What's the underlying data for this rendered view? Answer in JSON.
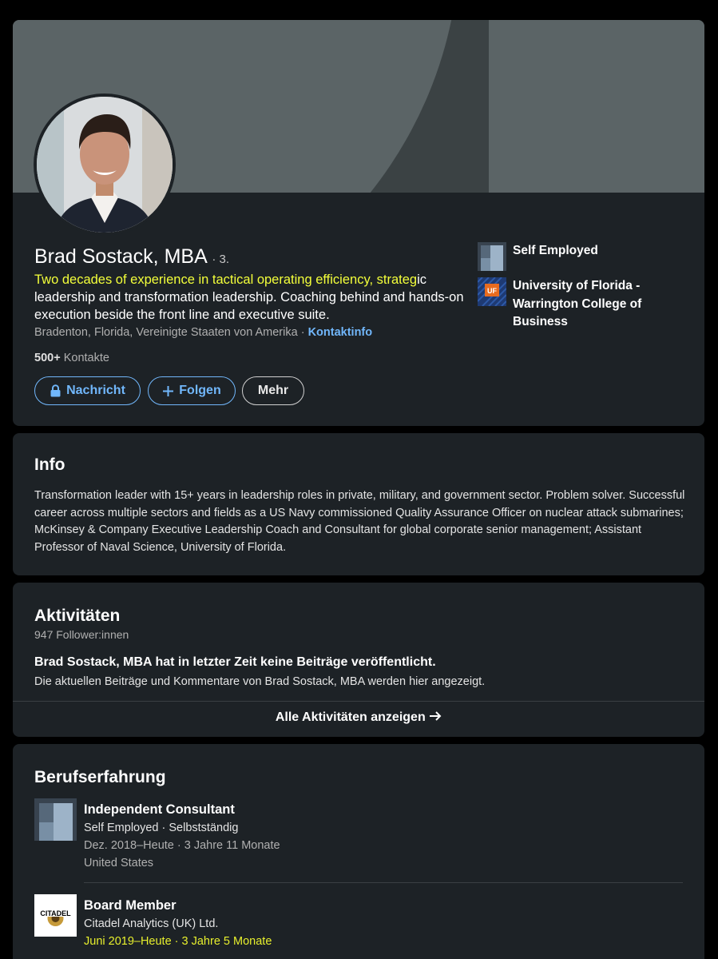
{
  "profile": {
    "name": "Brad Sostack, MBA",
    "degree": "· 3.",
    "headline_highlight": "Two decades of experience in tactical operating efficiency, strateg",
    "headline_rest": "ic leadership and transformation leadership. Coaching behind and hands-on execution beside the front line and executive suite.",
    "location": "Bradenton, Florida, Vereinigte Staaten von Amerika ·",
    "contact_link": "Kontaktinfo",
    "contacts_count": "500+",
    "contacts_label": "Kontakte",
    "buttons": {
      "message": "Nachricht",
      "follow": "Folgen",
      "more": "Mehr"
    },
    "side_company": "Self Employed",
    "side_school": "University of Florida - Warrington College of Business",
    "side_school_logo": "UF"
  },
  "info": {
    "title": "Info",
    "text": "Transformation leader with 15+ years in leadership roles in private, military, and government sector. Problem solver. Successful career across multiple sectors and fields as a US Navy commissioned Quality Assurance Officer on nuclear attack submarines; McKinsey & Company Executive Leadership Coach and Consultant for global corporate senior management; Assistant Professor of Naval Science, University of Florida."
  },
  "activity": {
    "title": "Aktivitäten",
    "followers": "947 Follower:innen",
    "no_posts_title": "Brad Sostack, MBA hat in letzter Zeit keine Beiträge veröffentlicht.",
    "no_posts_desc": "Die aktuellen Beiträge und Kommentare von Brad Sostack, MBA werden hier angezeigt.",
    "show_all": "Alle Aktivitäten anzeigen"
  },
  "experience": {
    "title": "Berufserfahrung",
    "items": [
      {
        "title": "Independent Consultant",
        "company": "Self Employed · Selbstständig",
        "dates": "Dez. 2018–Heute · 3 Jahre 11 Monate",
        "location": "United States"
      },
      {
        "title": "Board Member",
        "company": "Citadel Analytics (UK) Ltd.",
        "dates": "Juni 2019–Heute · 3 Jahre 5 Monate",
        "logo_text": "CITADEL"
      }
    ]
  },
  "colors": {
    "card_bg": "#1d2226",
    "link_blue": "#71b7fb",
    "highlight_yellow": "#f3ff3a"
  }
}
